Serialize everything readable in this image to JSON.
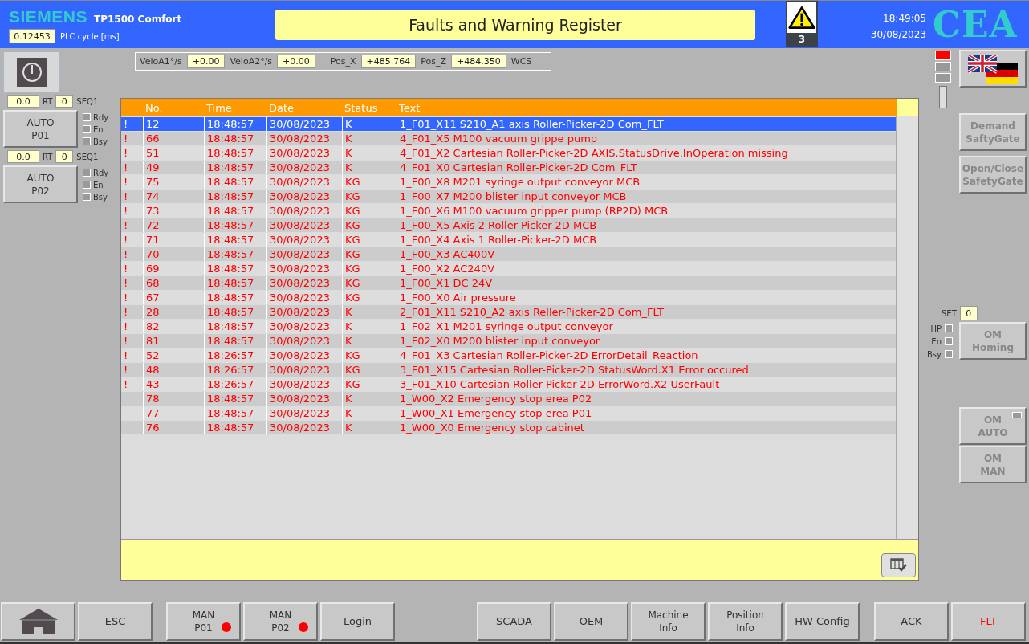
{
  "header": {
    "brand": "SIEMENS",
    "model": "TP1500 Comfort",
    "plc_cycle": {
      "value": "0.12453",
      "label": "PLC cycle [ms]"
    },
    "title": "Faults and Warning Register",
    "warnings": {
      "count": "3"
    },
    "time": "18:49:05",
    "date": "30/08/2023",
    "logo": "CEA"
  },
  "axes_bar": {
    "groups": [
      [
        {
          "label": "VeloA1°/s",
          "value": "+0.00"
        },
        {
          "label": "VeloA2°/s",
          "value": "+0.00"
        }
      ],
      [
        {
          "label": "Pos_X",
          "value": "+485.764"
        },
        {
          "label": "Pos_Z",
          "value": "+484.350"
        }
      ]
    ],
    "unit": "WCS"
  },
  "stations": [
    {
      "speed": "0.0",
      "speed_label": "RT",
      "seq": "0",
      "seq_label": "SEQ1",
      "button": [
        "AUTO",
        "P01"
      ],
      "flags": [
        {
          "label": "Rdy",
          "checked": false
        },
        {
          "label": "En",
          "checked": false
        },
        {
          "label": "Bsy",
          "checked": false
        }
      ]
    },
    {
      "speed": "0.0",
      "speed_label": "RT",
      "seq": "0",
      "seq_label": "SEQ1",
      "button": [
        "AUTO",
        "P02"
      ],
      "flags": [
        {
          "label": "Rdy",
          "checked": false
        },
        {
          "label": "En",
          "checked": false
        },
        {
          "label": "Bsy",
          "checked": false
        }
      ]
    }
  ],
  "table": {
    "columns": [
      "No.",
      "Time",
      "Date",
      "Status",
      "Text"
    ],
    "rows": [
      {
        "mark": "!",
        "no": "12",
        "time": "18:48:57",
        "date": "30/08/2023",
        "status": "K",
        "text": "1_F01_X11 S210_A1 axis Roller-Picker-2D Com_FLT",
        "selected": true
      },
      {
        "mark": "!",
        "no": "66",
        "time": "18:48:57",
        "date": "30/08/2023",
        "status": "K",
        "text": "4_F01_X5 M100 vacuum grippe pump",
        "selected": false
      },
      {
        "mark": "!",
        "no": "51",
        "time": "18:48:57",
        "date": "30/08/2023",
        "status": "K",
        "text": "4_F01_X2 Cartesian Roller-Picker-2D AXIS.StatusDrive.InOperation missing",
        "selected": false
      },
      {
        "mark": "!",
        "no": "49",
        "time": "18:48:57",
        "date": "30/08/2023",
        "status": "K",
        "text": "4_F01_X0 Cartesian Roller-Picker-2D Com_FLT",
        "selected": false
      },
      {
        "mark": "!",
        "no": "75",
        "time": "18:48:57",
        "date": "30/08/2023",
        "status": "KG",
        "text": "1_F00_X8 M201 syringe output conveyor MCB",
        "selected": false
      },
      {
        "mark": "!",
        "no": "74",
        "time": "18:48:57",
        "date": "30/08/2023",
        "status": "KG",
        "text": "1_F00_X7 M200 blister input conveyor MCB",
        "selected": false
      },
      {
        "mark": "!",
        "no": "73",
        "time": "18:48:57",
        "date": "30/08/2023",
        "status": "KG",
        "text": "1_F00_X6 M100 vacuum gripper pump (RP2D) MCB",
        "selected": false
      },
      {
        "mark": "!",
        "no": "72",
        "time": "18:48:57",
        "date": "30/08/2023",
        "status": "KG",
        "text": "1_F00_X5 Axis 2 Roller-Picker-2D MCB",
        "selected": false
      },
      {
        "mark": "!",
        "no": "71",
        "time": "18:48:57",
        "date": "30/08/2023",
        "status": "KG",
        "text": "1_F00_X4 Axis 1 Roller-Picker-2D MCB",
        "selected": false
      },
      {
        "mark": "!",
        "no": "70",
        "time": "18:48:57",
        "date": "30/08/2023",
        "status": "KG",
        "text": "1_F00_X3 AC400V",
        "selected": false
      },
      {
        "mark": "!",
        "no": "69",
        "time": "18:48:57",
        "date": "30/08/2023",
        "status": "KG",
        "text": "1_F00_X2 AC240V",
        "selected": false
      },
      {
        "mark": "!",
        "no": "68",
        "time": "18:48:57",
        "date": "30/08/2023",
        "status": "KG",
        "text": "1_F00_X1 DC 24V",
        "selected": false
      },
      {
        "mark": "!",
        "no": "67",
        "time": "18:48:57",
        "date": "30/08/2023",
        "status": "KG",
        "text": "1_F00_X0 Air pressure",
        "selected": false
      },
      {
        "mark": "!",
        "no": "28",
        "time": "18:48:57",
        "date": "30/08/2023",
        "status": "K",
        "text": "2_F01_X11 S210_A2 axis Reller-Picker-2D Com_FLT",
        "selected": false
      },
      {
        "mark": "!",
        "no": "82",
        "time": "18:48:57",
        "date": "30/08/2023",
        "status": "K",
        "text": "1_F02_X1 M201 syringe output conveyor",
        "selected": false
      },
      {
        "mark": "!",
        "no": "81",
        "time": "18:48:57",
        "date": "30/08/2023",
        "status": "K",
        "text": "1_F02_X0 M200 blister input conveyor",
        "selected": false
      },
      {
        "mark": "!",
        "no": "52",
        "time": "18:26:57",
        "date": "30/08/2023",
        "status": "KG",
        "text": "4_F01_X3 Cartesian Roller-Picker-2D ErrorDetail_Reaction",
        "selected": false
      },
      {
        "mark": "!",
        "no": "48",
        "time": "18:26:57",
        "date": "30/08/2023",
        "status": "KG",
        "text": "3_F01_X15 Cartesian Roller-Picker-2D StatusWord.X1 Error occured",
        "selected": false
      },
      {
        "mark": "!",
        "no": "43",
        "time": "18:26:57",
        "date": "30/08/2023",
        "status": "KG",
        "text": "3_F01_X10 Cartesian Roller-Picker-2D ErrorWord.X2 UserFault",
        "selected": false
      },
      {
        "no": "78",
        "time": "18:48:57",
        "date": "30/08/2023",
        "status": "K",
        "text": "1_W00_X2 Emergency stop erea P02",
        "selected": false
      },
      {
        "no": "77",
        "time": "18:48:57",
        "date": "30/08/2023",
        "status": "K",
        "text": "1_W00_X1 Emergency stop erea P01",
        "selected": false
      },
      {
        "no": "76",
        "time": "18:48:57",
        "date": "30/08/2023",
        "status": "K",
        "text": "1_W00_X0 Emergency stop cabinet",
        "selected": false
      }
    ]
  },
  "right_panel": {
    "lamps": [
      {
        "on": true
      },
      {
        "on": false
      },
      {
        "on": false
      }
    ],
    "buttons": [
      {
        "lines": [
          "Demand",
          "SaftyGate"
        ],
        "disabled": true
      },
      {
        "lines": [
          "Open/Close",
          "SafetyGate"
        ],
        "disabled": true
      }
    ],
    "homing": {
      "set_label": "SET",
      "set_value": "0",
      "flags": [
        {
          "label": "HP",
          "checked": false
        },
        {
          "label": "En",
          "checked": false
        },
        {
          "label": "Bsy",
          "checked": false
        }
      ],
      "button": {
        "lines": [
          "OM",
          "Homing"
        ],
        "disabled": true
      }
    },
    "mode_buttons": [
      {
        "lines": [
          "OM",
          "AUTO"
        ],
        "disabled": true,
        "lamp": {
          "on": false
        }
      },
      {
        "lines": [
          "OM",
          "MAN"
        ],
        "disabled": true
      }
    ]
  },
  "footer": {
    "groups": [
      [
        {
          "kind": "home"
        },
        {
          "kind": "text",
          "lines": [
            "ESC"
          ],
          "alarm": false,
          "highlighted": false
        }
      ],
      [
        {
          "kind": "text",
          "lines": [
            "MAN",
            "P01"
          ],
          "alarm": true,
          "highlighted": false
        },
        {
          "kind": "text",
          "lines": [
            "MAN",
            "P02"
          ],
          "alarm": true,
          "highlighted": false
        },
        {
          "kind": "text",
          "lines": [
            "Login"
          ],
          "alarm": false,
          "highlighted": false
        }
      ],
      [
        {
          "kind": "text",
          "lines": [
            "SCADA"
          ],
          "alarm": false,
          "highlighted": false
        },
        {
          "kind": "text",
          "lines": [
            "OEM"
          ],
          "alarm": false,
          "highlighted": false
        },
        {
          "kind": "text",
          "lines": [
            "Machine",
            "Info"
          ],
          "alarm": false,
          "highlighted": false
        },
        {
          "kind": "text",
          "lines": [
            "Position",
            "Info"
          ],
          "alarm": false,
          "highlighted": false
        },
        {
          "kind": "text",
          "lines": [
            "HW-Config"
          ],
          "alarm": false,
          "highlighted": false
        }
      ],
      [
        {
          "kind": "text",
          "lines": [
            "ACK"
          ],
          "alarm": false,
          "highlighted": false
        },
        {
          "kind": "text",
          "lines": [
            "FLT"
          ],
          "alarm": false,
          "highlighted": true
        }
      ]
    ]
  }
}
